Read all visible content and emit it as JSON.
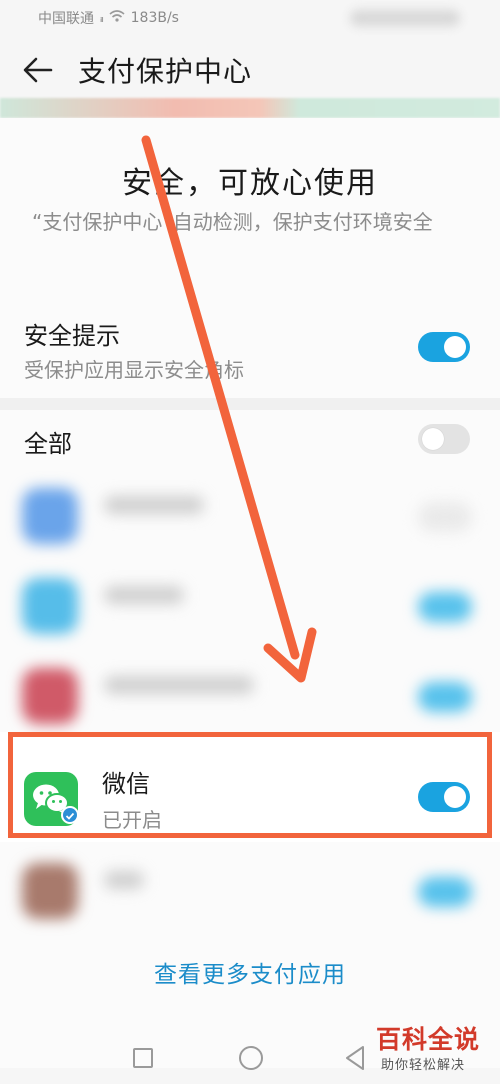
{
  "status_bar": {
    "carrier": "中国联通",
    "network_speed": "183B/s"
  },
  "header": {
    "title": "支付保护中心",
    "back_icon": "back-arrow-icon"
  },
  "security_summary": {
    "headline": "安全，可放心使用",
    "description": "“支付保护中心”自动检测，保护支付环境安全"
  },
  "settings": {
    "safety_tips": {
      "label": "安全提示",
      "sublabel": "受保护应用显示安全角标",
      "enabled": true
    },
    "all_apps": {
      "label": "全部",
      "enabled": false
    }
  },
  "apps": [
    {
      "name": "微信",
      "status": "已开启",
      "enabled": true,
      "icon": "wechat-icon"
    }
  ],
  "footer": {
    "more_link": "查看更多支付应用"
  },
  "watermark": {
    "title": "百科全说",
    "subtitle": "助你轻松解决"
  },
  "colors": {
    "toggle_on": "#1aa3e0",
    "link": "#1b8cc9",
    "annotation": "#f2643c",
    "wechat_green": "#2fc05a"
  }
}
